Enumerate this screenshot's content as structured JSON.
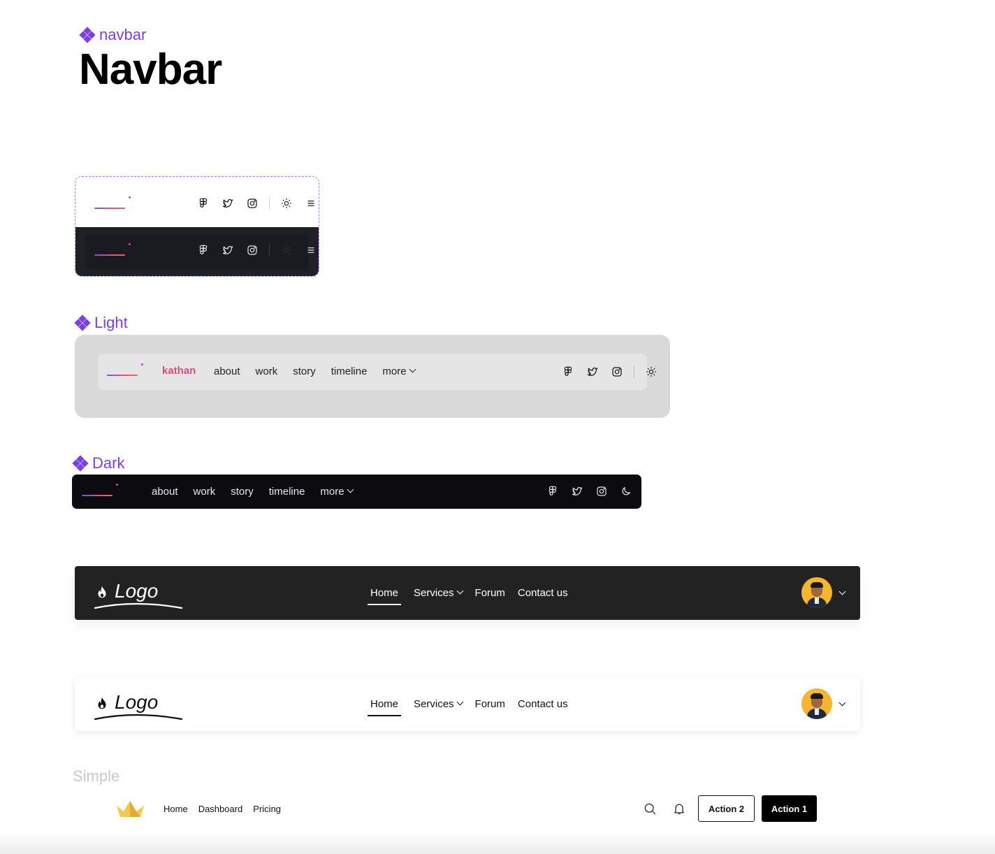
{
  "page": {
    "breadcrumb": "navbar",
    "title": "Navbar"
  },
  "colors": {
    "accent": "#7b3fe4",
    "dark_bg": "#202027",
    "light_panel": "#d9d9d9",
    "light_bar": "#e5e5e5",
    "dark_bar": "#0b0b10",
    "card_dark": "#222222",
    "brand_gradient": [
      "#5b5bf0",
      "#e24b8a",
      "#f06a4a"
    ]
  },
  "component_preview": {
    "icons": [
      "figma-icon",
      "twitter-icon",
      "instagram-icon",
      "sun-icon",
      "menu-icon"
    ]
  },
  "light": {
    "label": "Light",
    "brand": "kathan",
    "links": [
      "about",
      "work",
      "story",
      "timeline",
      "more"
    ],
    "icons": [
      "figma-icon",
      "twitter-icon",
      "instagram-icon",
      "sun-icon"
    ]
  },
  "dark": {
    "label": "Dark",
    "links": [
      "about",
      "work",
      "story",
      "timeline",
      "more"
    ],
    "icons": [
      "figma-icon",
      "twitter-icon",
      "instagram-icon",
      "moon-icon"
    ]
  },
  "card_dark_nav": {
    "logo": "Logo",
    "links": [
      "Home",
      "Services",
      "Forum",
      "Contact us"
    ],
    "active": "Home"
  },
  "card_light_nav": {
    "logo": "Logo",
    "links": [
      "Home",
      "Services",
      "Forum",
      "Contact us"
    ],
    "active": "Home"
  },
  "simple": {
    "label": "Simple",
    "links": [
      "Home",
      "Dashboard",
      "Pricing"
    ],
    "action2": "Action 2",
    "action1": "Action 1"
  }
}
